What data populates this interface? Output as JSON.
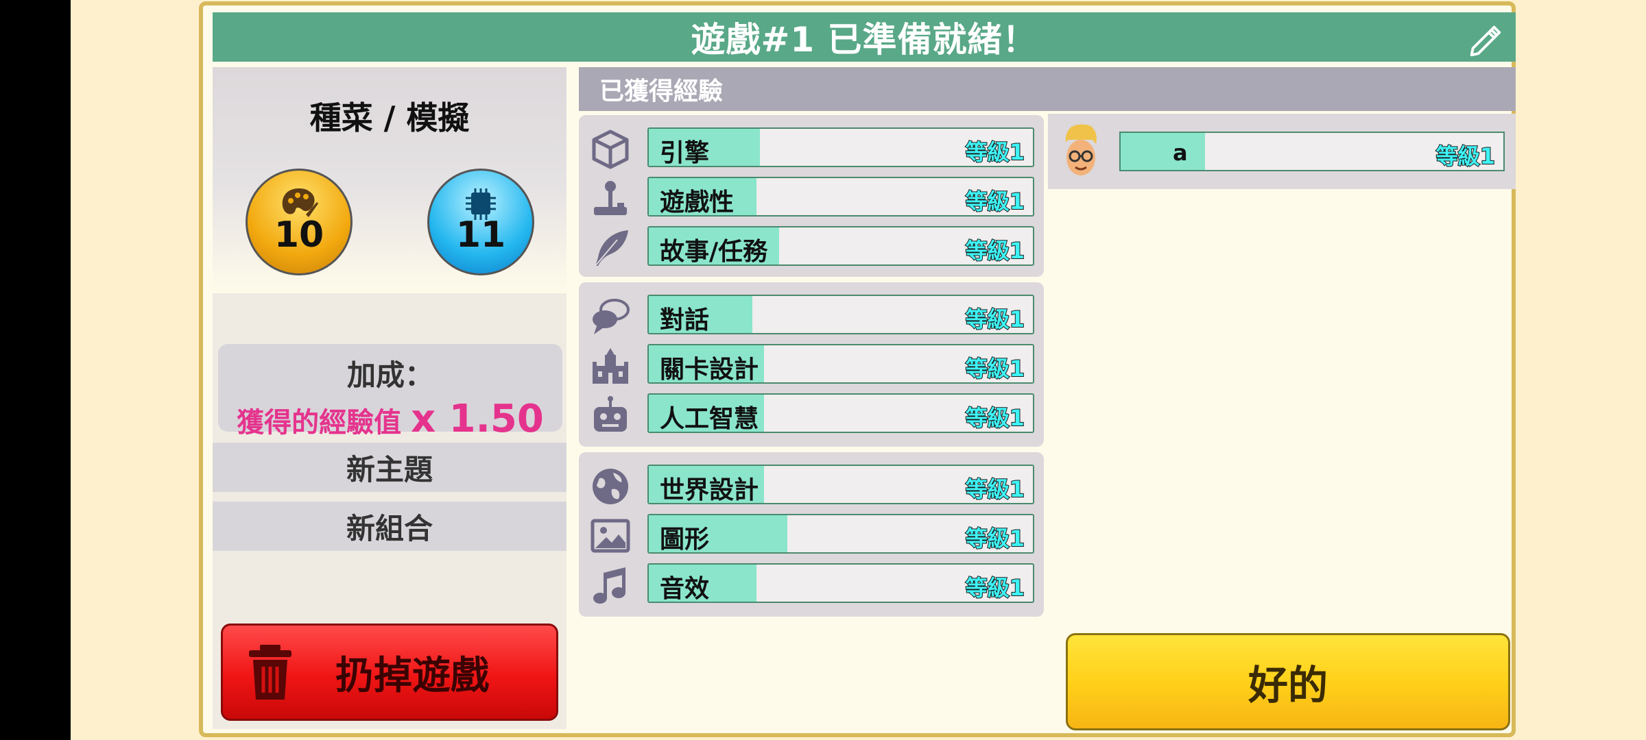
{
  "title": "遊戲#1 已準備就緒！",
  "left": {
    "genre": "種菜 / 模擬",
    "design_points": "10",
    "tech_points": "11",
    "bonus_label": "加成：",
    "bonus_text": "獲得的經驗值",
    "bonus_mult": "x 1.50",
    "new_topic": "新主題",
    "new_combo": "新組合",
    "trash_label": "扔掉遊戲"
  },
  "experience_header": "已獲得經驗",
  "skill_groups": [
    [
      {
        "name": "引擎",
        "level": "等級1",
        "progress": 0.29,
        "icon": "engine-cube-icon"
      },
      {
        "name": "遊戲性",
        "level": "等級1",
        "progress": 0.28,
        "icon": "joystick-icon"
      },
      {
        "name": "故事/任務",
        "level": "等級1",
        "progress": 0.34,
        "icon": "feather-icon"
      }
    ],
    [
      {
        "name": "對話",
        "level": "等級1",
        "progress": 0.27,
        "icon": "speech-bubbles-icon"
      },
      {
        "name": "關卡設計",
        "level": "等級1",
        "progress": 0.3,
        "icon": "castle-icon"
      },
      {
        "name": "人工智慧",
        "level": "等級1",
        "progress": 0.3,
        "icon": "robot-icon"
      }
    ],
    [
      {
        "name": "世界設計",
        "level": "等級1",
        "progress": 0.3,
        "icon": "globe-icon"
      },
      {
        "name": "圖形",
        "level": "等級1",
        "progress": 0.36,
        "icon": "picture-icon"
      },
      {
        "name": "音效",
        "level": "等級1",
        "progress": 0.28,
        "icon": "music-note-icon"
      }
    ]
  ],
  "staff": {
    "name": "a",
    "level": "等級1",
    "progress": 0.22
  },
  "ok_label": "好的",
  "colors": {
    "title_bar": "#59a888",
    "exp_fill": "#8ae5cb",
    "level_text": "#3ef3f5",
    "trash": "#f01515",
    "ok": "#ffd11a"
  }
}
